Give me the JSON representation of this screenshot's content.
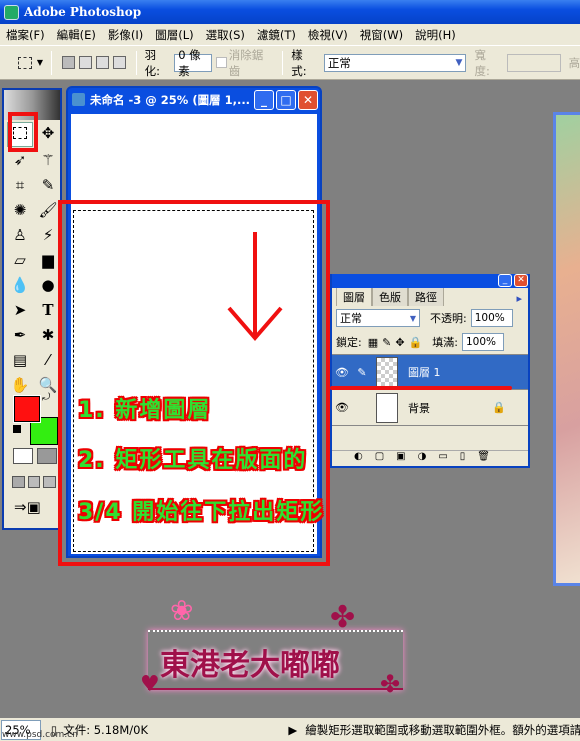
{
  "app": {
    "title": "Adobe Photoshop"
  },
  "menu": [
    "檔案(F)",
    "編輯(E)",
    "影像(I)",
    "圖層(L)",
    "選取(S)",
    "濾鏡(T)",
    "檢視(V)",
    "視窗(W)",
    "說明(H)"
  ],
  "options": {
    "feather_label": "羽化:",
    "feather_value": "0 像素",
    "antialias_label": "消除鋸齒",
    "style_label": "樣式:",
    "style_value": "正常",
    "width_label": "寬度:",
    "height_label": "高"
  },
  "document": {
    "title": "未命名 -3 @ 25% (圖層 1,..."
  },
  "layers_panel": {
    "tabs": [
      "圖層",
      "色版",
      "路徑"
    ],
    "blend_mode": "正常",
    "opacity_label": "不透明:",
    "opacity_value": "100%",
    "lock_label": "鎖定:",
    "fill_label": "填滿:",
    "fill_value": "100%",
    "layers": [
      {
        "name": "圖層 1",
        "selected": true
      },
      {
        "name": "背景",
        "locked": true
      }
    ]
  },
  "colors": {
    "foreground": "#ff1010",
    "background": "#33ee11",
    "annotation": "#f01010"
  },
  "annotations": [
    "1. 新增圖層",
    "2. 矩形工具在版面的",
    "3/4 開始往下拉出矩形"
  ],
  "logo": {
    "text": "東港老大嘟嘟"
  },
  "status": {
    "zoom": "25%",
    "doc_info": "文件: 5.18M/0K",
    "hint": "繪製矩形選取範圍或移動選取範圍外框。額外的選項請",
    "watermark": "www.psd.com.cn"
  }
}
